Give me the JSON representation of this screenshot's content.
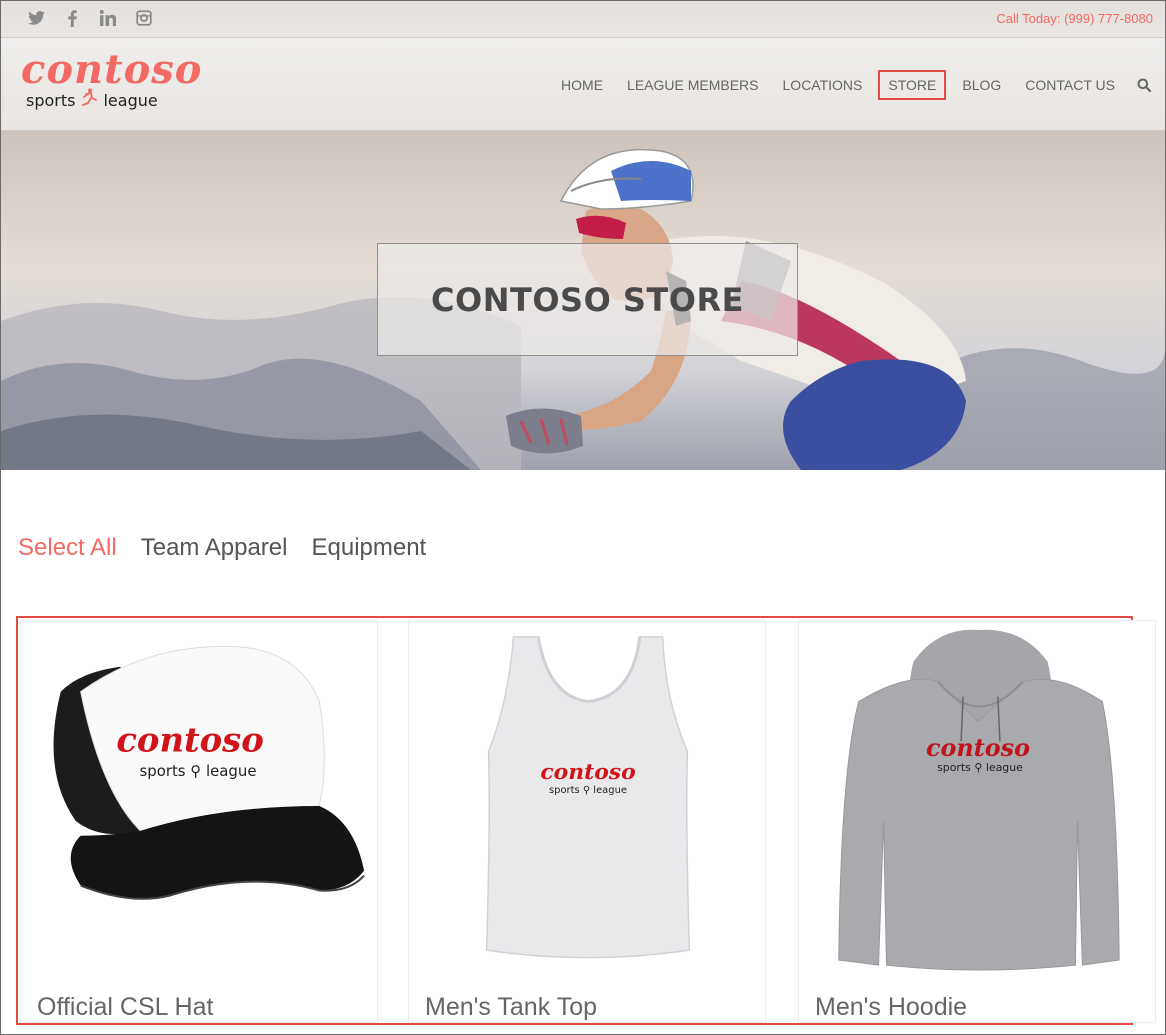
{
  "topbar": {
    "social_icons": [
      "twitter-icon",
      "facebook-icon",
      "linkedin-icon",
      "instagram-icon"
    ],
    "call_text": "Call Today: (999) 777-8080"
  },
  "brand": {
    "logo_script": "contoso",
    "logo_word1": "sports",
    "logo_word2": "league"
  },
  "nav": {
    "items": [
      {
        "label": "HOME"
      },
      {
        "label": "LEAGUE MEMBERS"
      },
      {
        "label": "LOCATIONS"
      },
      {
        "label": "STORE",
        "active": true
      },
      {
        "label": "BLOG"
      },
      {
        "label": "CONTACT US"
      }
    ],
    "search_icon": "search-icon"
  },
  "hero": {
    "title": "CONTOSO STORE"
  },
  "filters": [
    {
      "label": "Select All",
      "active": true
    },
    {
      "label": "Team Apparel"
    },
    {
      "label": "Equipment"
    }
  ],
  "products": [
    {
      "name": "Official CSL Hat"
    },
    {
      "name": "Men's Tank Top"
    },
    {
      "name": "Men's Hoodie"
    }
  ],
  "colors": {
    "accent": "#f26a63",
    "highlight_border": "#e04b43"
  }
}
